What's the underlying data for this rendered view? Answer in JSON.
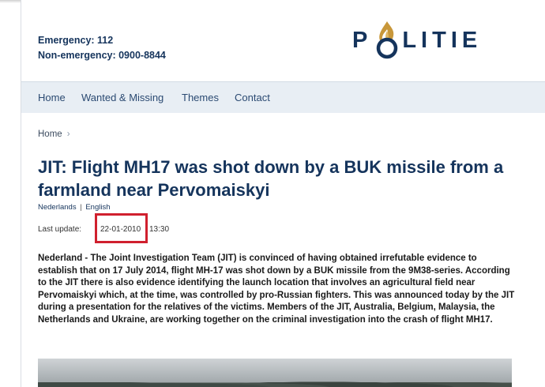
{
  "header": {
    "emergency": "Emergency: 112",
    "non_emergency": "Non-emergency: 0900-8844",
    "logo_text_before": "P",
    "logo_text_after": "LITIE",
    "brand_color": "#15345c",
    "emblem_color": "#c8973a"
  },
  "nav": {
    "items": [
      {
        "label": "Home"
      },
      {
        "label": "Wanted & Missing"
      },
      {
        "label": "Themes"
      },
      {
        "label": "Contact"
      }
    ]
  },
  "breadcrumb": {
    "home": "Home",
    "separator": "›"
  },
  "article": {
    "title": "JIT: Flight MH17 was shot down by a BUK missile from a farmland near Pervomaiskyi",
    "languages": {
      "dutch": "Nederlands",
      "separator": "|",
      "english": "English"
    },
    "last_update_label": "Last update:",
    "last_update_date": "22-01-2010",
    "last_update_time": "13:30",
    "highlight_color": "#d0202e",
    "intro": "Nederland - The Joint Investigation Team (JIT) is convinced of having obtained irrefutable evidence to establish that on 17 July 2014, flight MH-17 was shot down by a BUK missile from the 9M38-series. According to the JIT there is also evidence identifying the launch location that involves an agricultural field near Pervomaiskyi which, at the time, was controlled by pro-Russian fighters. This was announced today by the JIT during a presentation for the relatives of the victims. Members of the JIT, Australia, Belgium, Malaysia, the Netherlands and Ukraine, are working together on the criminal investigation into the crash of flight MH17."
  }
}
